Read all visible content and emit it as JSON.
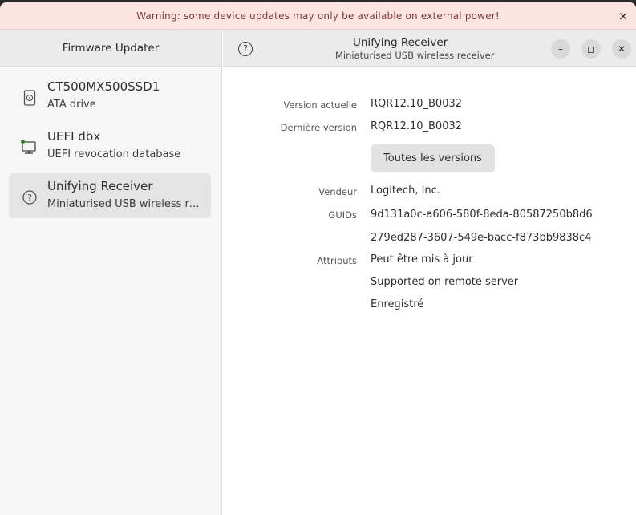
{
  "banner": {
    "text": "Warning: some device updates may only be available on external power!",
    "close_icon": "×"
  },
  "sidebar": {
    "title": "Firmware Updater",
    "devices": [
      {
        "name": "CT500MX500SSD1",
        "description": "ATA drive",
        "icon": "drive-icon"
      },
      {
        "name": "UEFI dbx",
        "description": "UEFI revocation database",
        "icon": "computer-icon"
      },
      {
        "name": "Unifying Receiver",
        "description": "Miniaturised USB wireless receiver",
        "icon": "help-icon"
      }
    ]
  },
  "header": {
    "help_icon": "?",
    "title": "Unifying Receiver",
    "subtitle": "Miniaturised USB wireless receiver",
    "minimize_icon": "–",
    "maximize_icon": "◻",
    "close_icon": "✕"
  },
  "details": {
    "current_version_label": "Version actuelle",
    "current_version": "RQR12.10_B0032",
    "latest_version_label": "Dernière version",
    "latest_version": "RQR12.10_B0032",
    "all_versions_button": "Toutes les versions",
    "vendor_label": "Vendeur",
    "vendor": "Logitech, Inc.",
    "guids_label": "GUIDs",
    "guids": [
      "9d131a0c-a606-580f-8eda-80587250b8d6",
      "279ed287-3607-549e-bacc-f873bb9838c4"
    ],
    "attributes_label": "Attributs",
    "attributes": [
      "Peut être mis à jour",
      "Supported on remote server",
      "Enregistré"
    ]
  },
  "colors": {
    "banner_bg": "#fce4e1",
    "selected_row": "#e4e4e4",
    "status_dot": "#2e7d32"
  }
}
